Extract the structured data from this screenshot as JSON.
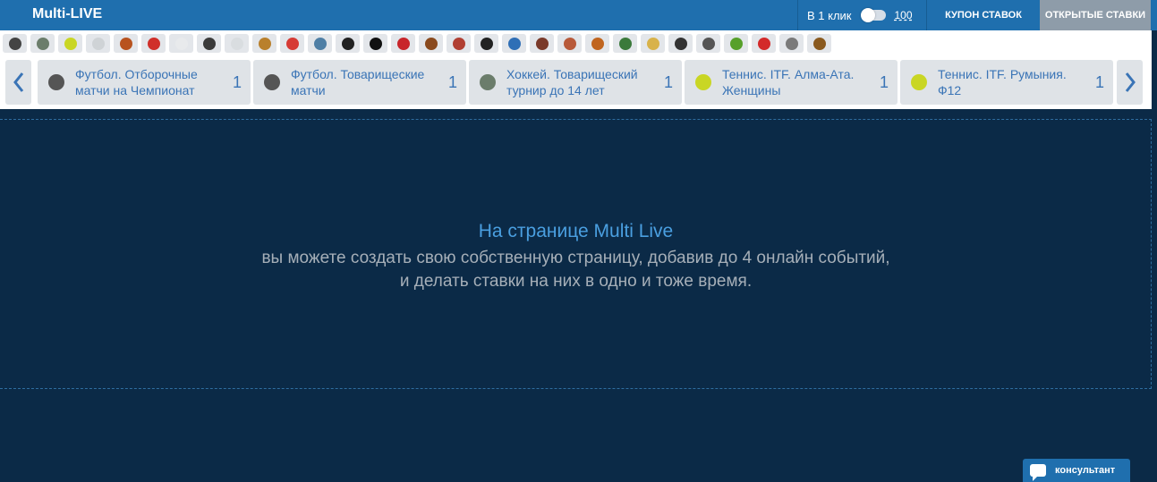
{
  "header": {
    "title": "Multi-LIVE",
    "one_click_label": "В 1 клик",
    "one_click_amount": "100",
    "coupon_label": "КУПОН СТАВОК",
    "open_bets_label": "ОТКРЫТЫЕ СТАВКИ"
  },
  "sports": [
    {
      "icon": "soccer-ball-icon",
      "color": "#444"
    },
    {
      "icon": "hockey-skate-icon",
      "color": "#6b7d6b"
    },
    {
      "icon": "tennis-ball-icon",
      "color": "#c9d624"
    },
    {
      "icon": "volleyball-icon",
      "color": "#cfd3d6"
    },
    {
      "icon": "american-football-icon",
      "color": "#b8531f"
    },
    {
      "icon": "table-tennis-icon",
      "color": "#d0302a"
    },
    {
      "icon": "golf-ball-icon",
      "color": "#e8eaec"
    },
    {
      "icon": "gamepad-icon",
      "color": "#3b3b3b"
    },
    {
      "icon": "snooker-ball-icon",
      "color": "#d9dde0"
    },
    {
      "icon": "horse-racing-icon",
      "color": "#b9802c"
    },
    {
      "icon": "cap-icon",
      "color": "#d63b35"
    },
    {
      "icon": "rowing-icon",
      "color": "#4f7fa5"
    },
    {
      "icon": "panda-icon",
      "color": "#222"
    },
    {
      "icon": "counter-strike-icon",
      "color": "#111"
    },
    {
      "icon": "ufc-icon",
      "color": "#c8262b"
    },
    {
      "icon": "dog-racing-icon",
      "color": "#8a4a1e"
    },
    {
      "icon": "hurling-icon",
      "color": "#b13f32"
    },
    {
      "icon": "mortal-kombat-icon",
      "color": "#222"
    },
    {
      "icon": "shield-icon",
      "color": "#2f6fb6"
    },
    {
      "icon": "dota-hero-icon",
      "color": "#7a3a2a"
    },
    {
      "icon": "helmet-icon",
      "color": "#b85a3a"
    },
    {
      "icon": "boxing-icon",
      "color": "#c0651f"
    },
    {
      "icon": "turtle-icon",
      "color": "#3b7a3b"
    },
    {
      "icon": "star-icon",
      "color": "#d8b24a"
    },
    {
      "icon": "warrior-icon",
      "color": "#333"
    },
    {
      "icon": "shooting-icon",
      "color": "#555"
    },
    {
      "icon": "lizard-icon",
      "color": "#57a02a"
    },
    {
      "icon": "angry-bird-icon",
      "color": "#d32a2a"
    },
    {
      "icon": "controller-icon",
      "color": "#7a7a7a"
    },
    {
      "icon": "heroes-icon",
      "color": "#8a5a1f"
    }
  ],
  "events": [
    {
      "icon": "soccer-ball-icon",
      "color": "#555",
      "name": "Футбол. Отборочные матчи на Чемпионат",
      "count": "1"
    },
    {
      "icon": "soccer-ball-icon",
      "color": "#555",
      "name": "Футбол. Товарищеские матчи",
      "count": "1"
    },
    {
      "icon": "hockey-skate-icon",
      "color": "#6b7d6b",
      "name": "Хоккей. Товарищеский турнир до 14 лет",
      "count": "1"
    },
    {
      "icon": "tennis-ball-icon",
      "color": "#c9d624",
      "name": "Теннис. ITF. Алма-Ата. Женщины",
      "count": "1"
    },
    {
      "icon": "tennis-ball-icon",
      "color": "#c9d624",
      "name": "Теннис. ITF. Румыния. Ф12",
      "count": "1"
    }
  ],
  "dropzone": {
    "title": "На странице Multi Live",
    "line1": "вы можете создать свою собственную страницу, добавив до 4 онлайн событий,",
    "line2": "и делать ставки на них в одно и тоже время."
  },
  "consultant": {
    "label": "консультант"
  }
}
